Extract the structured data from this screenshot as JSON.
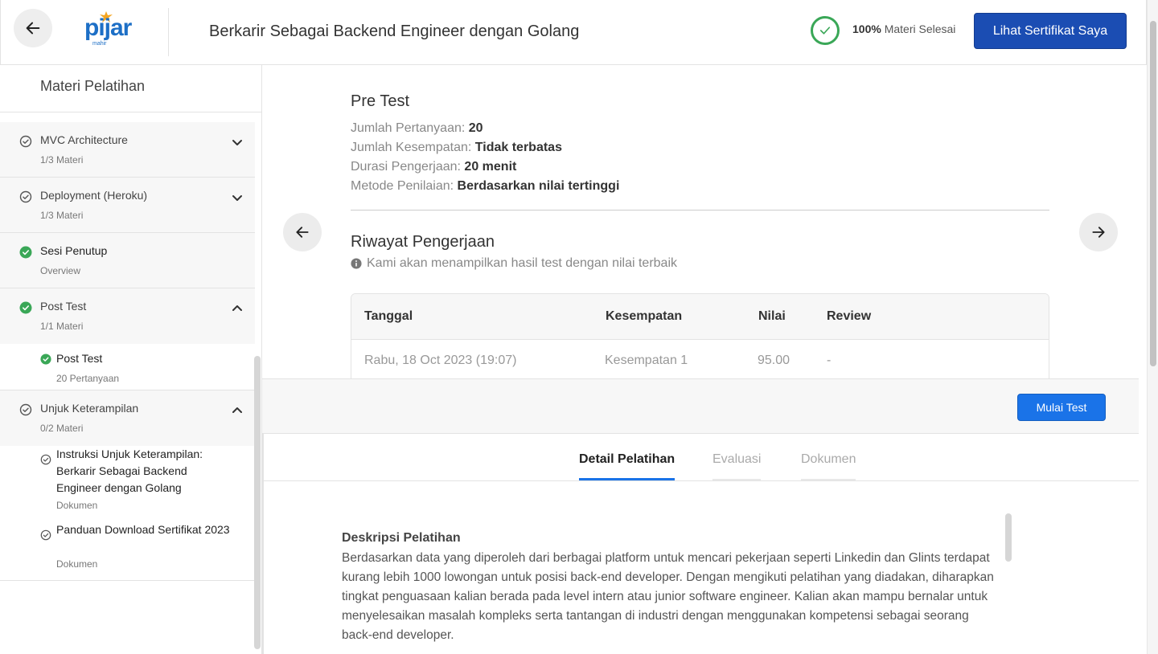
{
  "header": {
    "logo_text": "pijar",
    "logo_sub": "mahir",
    "course_title": "Berkarir Sebagai Backend Engineer dengan Golang",
    "progress_value": "100%",
    "progress_label": "Materi Selesai",
    "certificate_button": "Lihat Sertifikat Saya"
  },
  "sidebar": {
    "title": "Materi Pelatihan",
    "sections": [
      {
        "name": "MVC Architecture",
        "count": "1/3 Materi",
        "status": "in-progress",
        "expanded": false
      },
      {
        "name": "Deployment (Heroku)",
        "count": "1/3 Materi",
        "status": "in-progress",
        "expanded": false
      },
      {
        "name": "Sesi Penutup",
        "count": "Overview",
        "status": "done",
        "expanded": false
      },
      {
        "name": "Post Test",
        "count": "1/1 Materi",
        "status": "done",
        "expanded": true
      },
      {
        "name": "Unjuk Keterampilan",
        "count": "0/2 Materi",
        "status": "in-progress",
        "expanded": true
      }
    ],
    "post_test_items": [
      {
        "name": "Post Test",
        "meta": "20 Pertanyaan"
      }
    ],
    "unjuk_items": [
      {
        "name": "Instruksi Unjuk Keterampilan: Berkarir Sebagai Backend Engineer dengan Golang",
        "meta": "Dokumen"
      },
      {
        "name": "Panduan Download Sertifikat 2023",
        "meta": "Dokumen"
      }
    ]
  },
  "test": {
    "title": "Pre Test",
    "questions_label": "Jumlah Pertanyaan:",
    "questions_value": "20",
    "attempts_label": "Jumlah Kesempatan:",
    "attempts_value": "Tidak terbatas",
    "duration_label": "Durasi Pengerjaan:",
    "duration_value": "20 menit",
    "method_label": "Metode Penilaian:",
    "method_value": "Berdasarkan nilai tertinggi",
    "history_title": "Riwayat Pengerjaan",
    "history_note": "Kami akan menampilkan hasil test dengan nilai terbaik",
    "table": {
      "headers": [
        "Tanggal",
        "Kesempatan",
        "Nilai",
        "Review"
      ],
      "rows": [
        [
          "Rabu, 18 Oct 2023 (19:07)",
          "Kesempatan 1",
          "95.00",
          "-"
        ]
      ]
    },
    "start_button": "Mulai Test"
  },
  "tabs": [
    {
      "label": "Detail Pelatihan",
      "active": true
    },
    {
      "label": "Evaluasi",
      "active": false
    },
    {
      "label": "Dokumen",
      "active": false
    }
  ],
  "description": {
    "title": "Deskripsi Pelatihan",
    "body": "Berdasarkan data yang diperoleh dari berbagai platform untuk mencari pekerjaan seperti Linkedin dan Glints terdapat kurang lebih 1000 lowongan untuk posisi back-end developer. Dengan mengikuti pelatihan yang diadakan, diharapkan tingkat penguasaan kalian berada pada level intern atau junior software engineer. Kalian akan mampu bernalar untuk menyelesaikan masalah kompleks serta tantangan di industri dengan menggunakan kompetensi sebagai seorang back-end developer."
  },
  "colors": {
    "primary": "#1a73e8",
    "certificate_button": "#1b4db3",
    "success": "#3aa757",
    "logo": "#1d6fc6",
    "logo_accent": "#f5a623"
  },
  "icons": {
    "back": "arrow-left-icon",
    "progress": "check-circle-icon",
    "section_done": "check-circle-filled-icon",
    "section_pending": "check-circle-outline-icon",
    "collapse": "chevron-up-icon",
    "expand": "chevron-down-icon",
    "info": "info-icon",
    "prev": "arrow-left-icon",
    "next": "arrow-right-icon"
  }
}
